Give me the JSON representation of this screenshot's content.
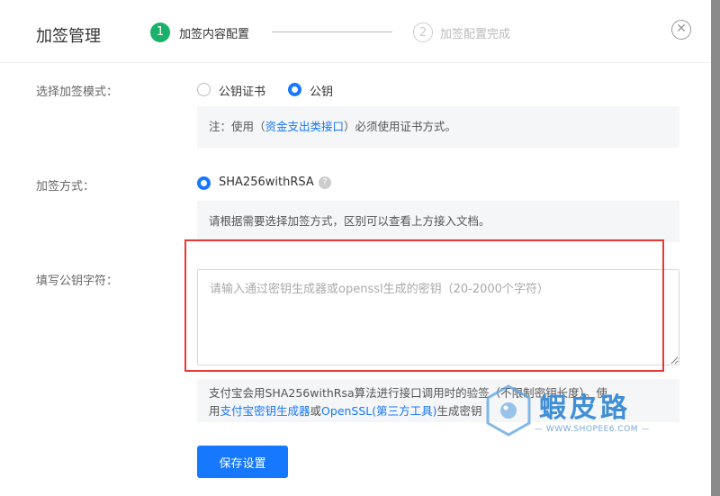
{
  "header": {
    "title": "加签管理",
    "steps": [
      {
        "num": "1",
        "label": "加签内容配置"
      },
      {
        "num": "2",
        "label": "加签配置完成"
      }
    ],
    "close_glyph": "✕"
  },
  "mode": {
    "label": "选择加签模式：",
    "options": [
      "公钥证书",
      "公钥"
    ],
    "selected": "公钥",
    "note_prefix": "注：使用（",
    "note_link": "资金支出类接口",
    "note_suffix": "）必须使用证书方式。"
  },
  "method": {
    "label": "加签方式：",
    "option": "SHA256withRSA",
    "help_glyph": "?",
    "note": "请根据需要选择加签方式，区别可以查看上方接入文档。"
  },
  "pubkey": {
    "label": "填写公钥字符：",
    "placeholder": "请输入通过密钥生成器或openssl生成的密钥（20-2000个字符）",
    "value": "",
    "note_line1": "支付宝会用SHA256withRsa算法进行接口调用时的验签（不限制密钥长度）。使",
    "note_line2_prefix": "用",
    "note_link1": "支付宝密钥生成器",
    "note_mid": "或",
    "note_link2": "OpenSSL(第三方工具)",
    "note_line2_suffix": "生成密钥"
  },
  "save_label": "保存设置",
  "watermark": {
    "text": "蝦皮路",
    "sub": "— WWW.SHOPEE6.COM —"
  },
  "colors": {
    "primary": "#1677ff",
    "step_active": "#1ab26b",
    "highlight_frame": "#e53935"
  }
}
